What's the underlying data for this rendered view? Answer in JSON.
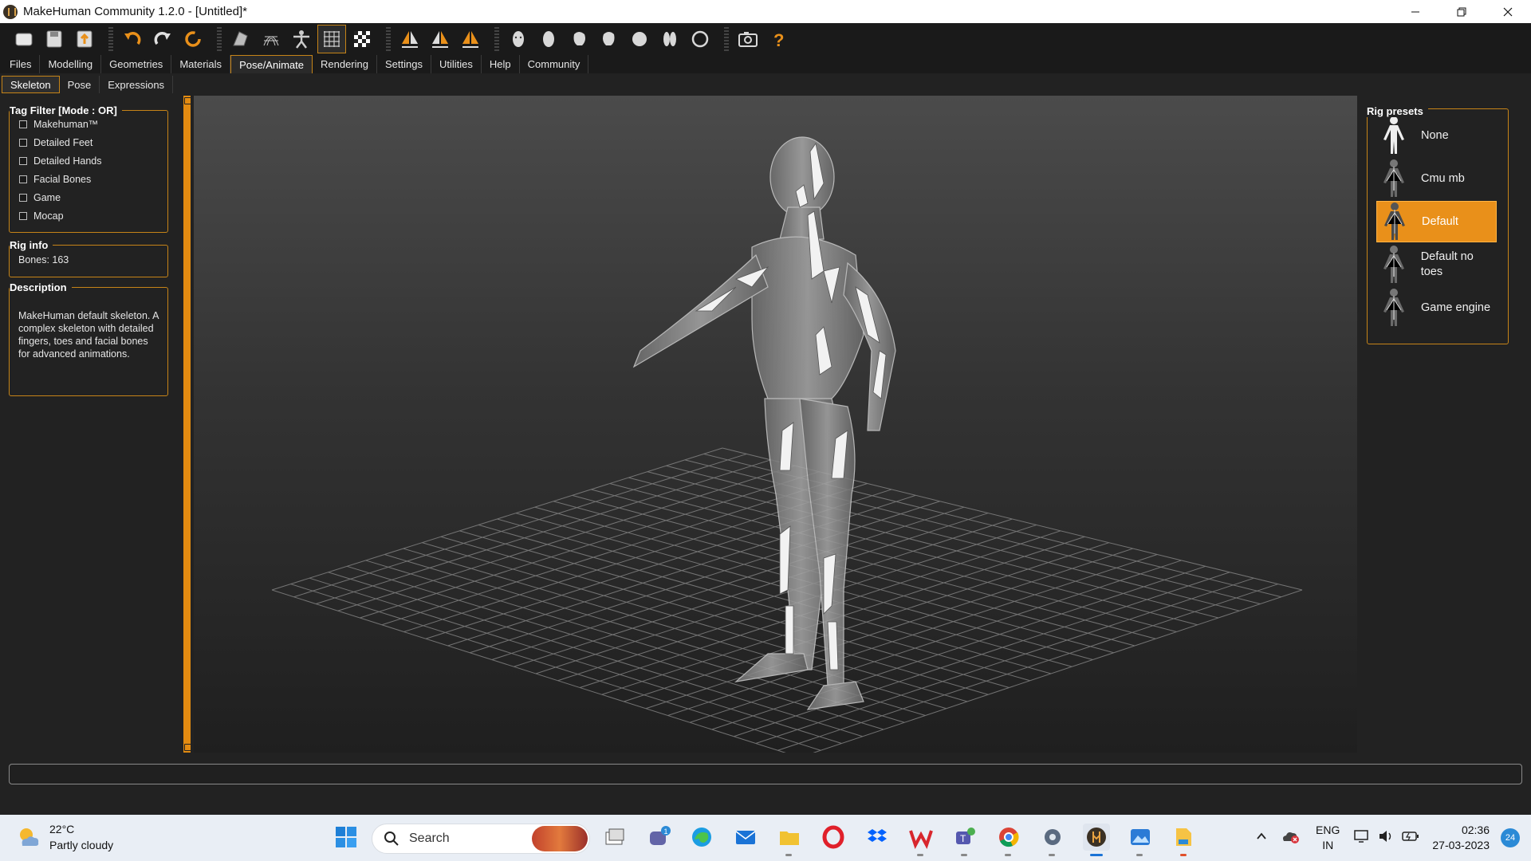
{
  "window": {
    "title": "MakeHuman Community 1.2.0 - [Untitled]*",
    "controls": [
      "minimize",
      "restore",
      "close"
    ]
  },
  "toolbar": {
    "icons": [
      "open-folder-icon",
      "save-icon",
      "export-icon",
      "undo-icon",
      "redo-icon",
      "reset-icon",
      "smooth-icon",
      "wireframe-icon",
      "pose-icon",
      "grid-icon",
      "checker-icon",
      "symmetry-right-icon",
      "symmetry-left-icon",
      "symmetry-icon",
      "front-view-icon",
      "back-view-icon",
      "left-view-icon",
      "right-view-icon",
      "top-view-icon",
      "bottom-view-icon",
      "reset-camera-icon",
      "screenshot-icon",
      "help-icon"
    ],
    "active_icon": "grid-icon"
  },
  "main_tabs": [
    {
      "label": "Files"
    },
    {
      "label": "Modelling"
    },
    {
      "label": "Geometries"
    },
    {
      "label": "Materials"
    },
    {
      "label": "Pose/Animate",
      "active": true
    },
    {
      "label": "Rendering"
    },
    {
      "label": "Settings"
    },
    {
      "label": "Utilities"
    },
    {
      "label": "Help"
    },
    {
      "label": "Community"
    }
  ],
  "sub_tabs": [
    {
      "label": "Skeleton",
      "active": true
    },
    {
      "label": "Pose"
    },
    {
      "label": "Expressions"
    }
  ],
  "left_panel": {
    "tag_filter": {
      "title": "Tag Filter [Mode : OR]",
      "items": [
        "Makehuman™",
        "Detailed Feet",
        "Detailed Hands",
        "Facial Bones",
        "Game",
        "Mocap"
      ]
    },
    "rig_info": {
      "title": "Rig info",
      "bones": "Bones: 163"
    },
    "description": {
      "title": "Description",
      "text": "MakeHuman default skeleton. A complex skeleton with detailed fingers, toes and facial bones for advanced animations."
    }
  },
  "right_panel": {
    "title": "Rig presets",
    "presets": [
      {
        "label": "None"
      },
      {
        "label": "Cmu mb"
      },
      {
        "label": "Default",
        "selected": true
      },
      {
        "label": "Default no toes"
      },
      {
        "label": "Game engine"
      }
    ]
  },
  "status": {
    "text": ""
  },
  "colors": {
    "accent": "#e9901a",
    "border": "#c68418",
    "panel_bg": "#222222"
  },
  "taskbar": {
    "weather": {
      "temp": "22°C",
      "condition": "Partly cloudy"
    },
    "search_label": "Search",
    "apps": [
      "start-icon",
      "task-view-icon",
      "teams-chat-icon",
      "edge-icon",
      "mail-icon",
      "file-explorer-icon",
      "opera-icon",
      "dropbox-icon",
      "wps-icon",
      "teams-icon",
      "chrome-icon",
      "settings-icon",
      "makehuman-icon",
      "photos-icon",
      "files-icon"
    ],
    "tray": {
      "language": "ENG",
      "region": "IN",
      "time": "02:36",
      "date": "27-03-2023",
      "notifications": "24"
    }
  }
}
